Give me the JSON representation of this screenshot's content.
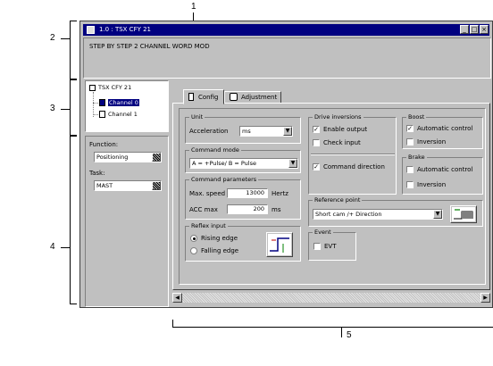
{
  "callouts": {
    "c1": "1",
    "c2": "2",
    "c3": "3",
    "c4": "4",
    "c5": "5"
  },
  "window": {
    "title": "1.0 : TSX CFY 21",
    "header_text": "STEP BY STEP 2 CHANNEL WORD MOD"
  },
  "tree": {
    "root": "TSX CFY 21",
    "items": [
      {
        "label": "Channel 0",
        "selected": true
      },
      {
        "label": "Channel 1",
        "selected": false
      }
    ]
  },
  "function_panel": {
    "function_label": "Function:",
    "function_value": "Positioning",
    "task_label": "Task:",
    "task_value": "MAST"
  },
  "tabs": [
    {
      "label": "Config",
      "active": true
    },
    {
      "label": "Adjustment",
      "active": false
    }
  ],
  "unit": {
    "title": "Unit",
    "acceleration_label": "Acceleration",
    "acceleration_value": "ms"
  },
  "command_mode": {
    "title": "Command mode",
    "value": "A = +Pulse/ B = Pulse"
  },
  "command_parameters": {
    "title": "Command parameters",
    "max_speed_label": "Max. speed",
    "max_speed_value": "13000",
    "max_speed_unit": "Hertz",
    "acc_max_label": "ACC max",
    "acc_max_value": "200",
    "acc_max_unit": "ms"
  },
  "reflex_input": {
    "title": "Reflex input",
    "rising": "Rising edge",
    "falling": "Falling edge",
    "selected": "rising"
  },
  "drive_inversions": {
    "title": "Drive inversions",
    "enable_output": "Enable output",
    "enable_output_checked": true,
    "check_input": "Check input",
    "check_input_checked": false,
    "command_direction": "Command direction",
    "command_direction_checked": true
  },
  "boost": {
    "title": "Boost",
    "automatic_control": "Automatic control",
    "automatic_control_checked": true,
    "inversion": "Inversion",
    "inversion_checked": false
  },
  "brake": {
    "title": "Brake",
    "automatic_control": "Automatic control",
    "automatic_control_checked": false,
    "inversion": "Inversion",
    "inversion_checked": false
  },
  "reference_point": {
    "title": "Reference point",
    "value": "Short cam /+ Direction"
  },
  "event": {
    "title": "Event",
    "evt_label": "EVT",
    "evt_checked": false
  },
  "icons": {
    "dropdown": "dropdown-arrow-icon",
    "scroll_left": "arrow-left-icon",
    "scroll_right": "arrow-right-icon"
  }
}
